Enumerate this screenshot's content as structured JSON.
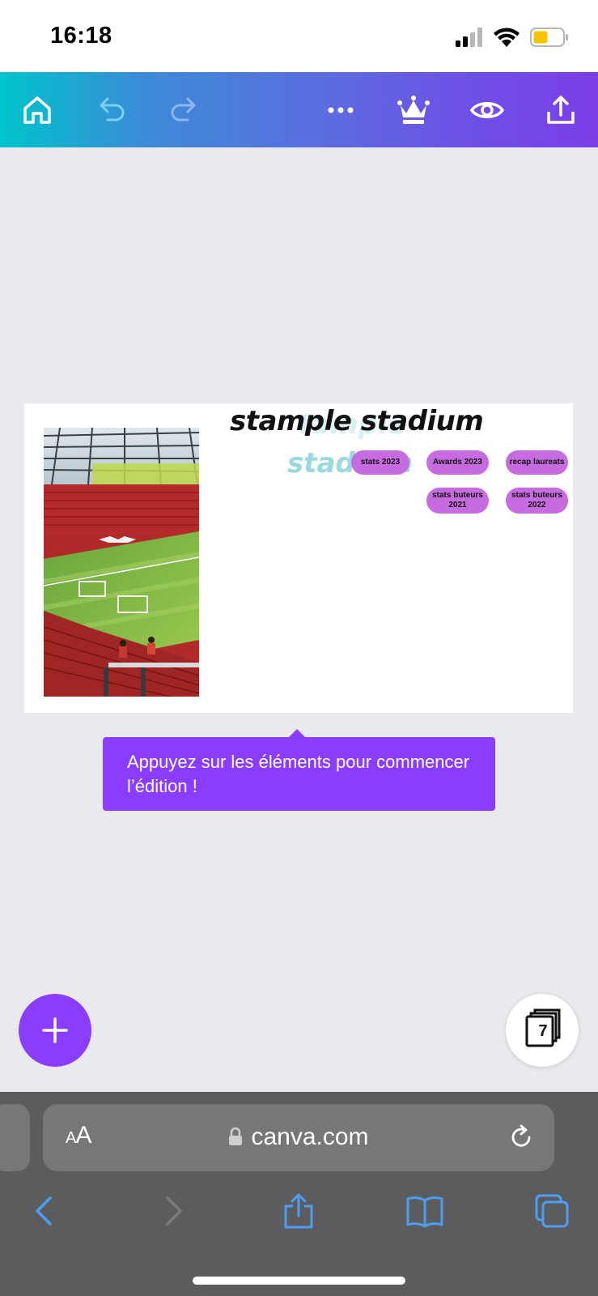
{
  "status": {
    "time": "16:18"
  },
  "toolbar": {
    "icons": [
      "home-icon",
      "undo-icon",
      "redo-icon",
      "more-icon",
      "crown-icon",
      "eye-icon",
      "share-icon"
    ]
  },
  "design": {
    "title": "stample stadium",
    "ghost_text_1": "tample",
    "ghost_text_2": "stadium",
    "buttons": {
      "stats_2023": "stats 2023",
      "awards_2023": "Awards 2023",
      "recap_laureats": "recap laureats",
      "stats_buteurs_2021": "stats buteurs 2021",
      "stats_buteurs_2022": "stats buteurs 2022"
    }
  },
  "tooltip": {
    "text": "Appuyez sur les éléments pour commencer l’édition !"
  },
  "fab": {
    "pages_count": "7"
  },
  "safari": {
    "aa_small": "A",
    "aa_large": "A",
    "url": "canva.com"
  },
  "colors": {
    "accent": "#8b3dff",
    "pill": "#c76ce0",
    "toolbar_start": "#00c4cc",
    "toolbar_end": "#7b3ee8"
  }
}
